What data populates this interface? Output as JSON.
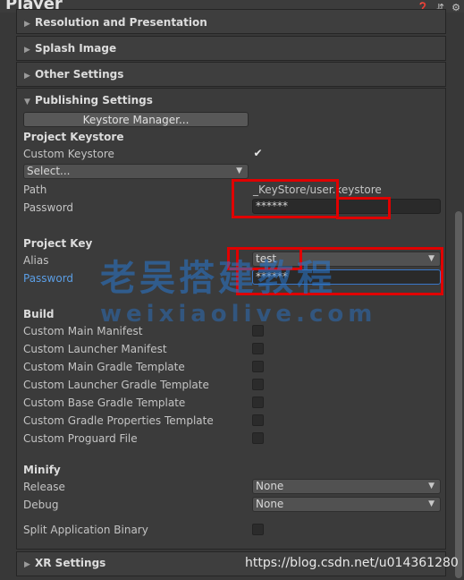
{
  "window": {
    "title": "Player",
    "icons": [
      "help-icon",
      "settings-sliders-icon",
      "gear-icon"
    ]
  },
  "sections": {
    "resolution": "Resolution and Presentation",
    "splash": "Splash Image",
    "other": "Other Settings",
    "publishing": "Publishing Settings",
    "xr": "XR Settings"
  },
  "publishing": {
    "keystore_manager_button": "Keystore Manager...",
    "project_keystore_heading": "Project Keystore",
    "custom_keystore_label": "Custom Keystore",
    "custom_keystore_checked": true,
    "keystore_select": "Select...",
    "path_label": "Path",
    "path_value": "_KeyStore/user.keystore",
    "password_label": "Password",
    "keystore_password": "******",
    "project_key_heading": "Project Key",
    "alias_label": "Alias",
    "alias_value": "test",
    "key_password_label": "Password",
    "key_password_value": "******",
    "build_heading": "Build",
    "build_options": [
      "Custom Main Manifest",
      "Custom Launcher Manifest",
      "Custom Main Gradle Template",
      "Custom Launcher Gradle Template",
      "Custom Base Gradle Template",
      "Custom Gradle Properties Template",
      "Custom Proguard File"
    ],
    "minify_heading": "Minify",
    "release_label": "Release",
    "release_value": "None",
    "debug_label": "Debug",
    "debug_value": "None",
    "split_binary_label": "Split Application Binary"
  },
  "overlays": {
    "watermark_cn": "老吴搭建教程",
    "watermark_en": "weixiaolive.com",
    "url": "https://blog.csdn.net/u014361280"
  },
  "colors": {
    "background": "#383838",
    "highlight": "#e00000",
    "focus_blue": "#3a78c9"
  }
}
